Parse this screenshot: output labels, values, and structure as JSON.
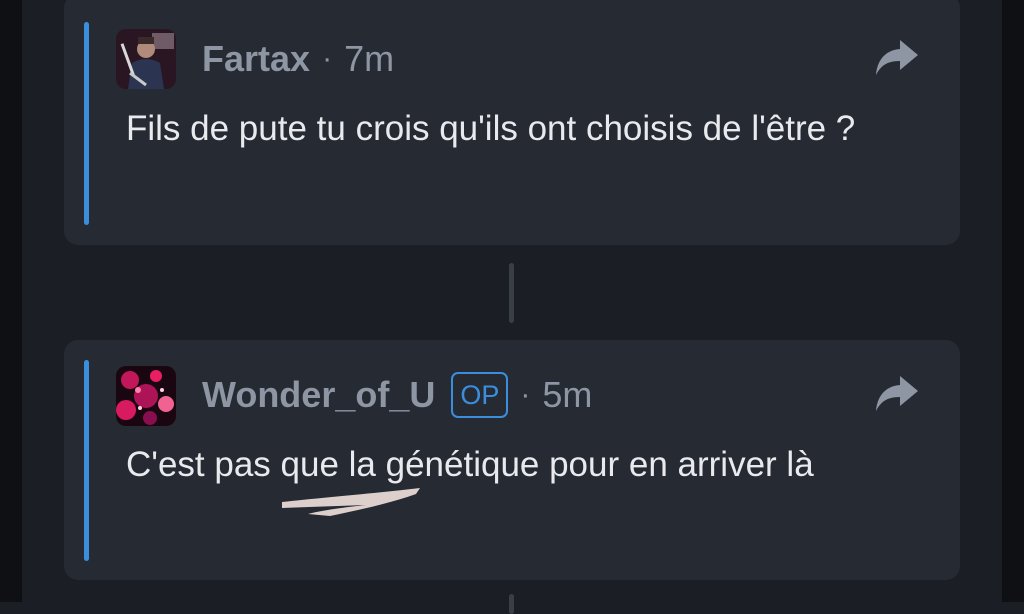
{
  "comments": [
    {
      "username": "Fartax",
      "separator": "·",
      "time": "7m",
      "op_badge": "",
      "text": "Fils de pute tu crois qu'ils ont choisis de l'être ?",
      "share_icon": "share-icon"
    },
    {
      "username": "Wonder_of_U",
      "separator": "·",
      "time": "5m",
      "op_badge": "OP",
      "text": "C'est pas que la génétique pour en arriver là",
      "share_icon": "share-icon"
    }
  ],
  "colors": {
    "accent": "#3b8ede",
    "card": "#262a33",
    "background": "#1b1e24",
    "meta_text": "#8e96a4",
    "body_text": "#e8eaee"
  }
}
